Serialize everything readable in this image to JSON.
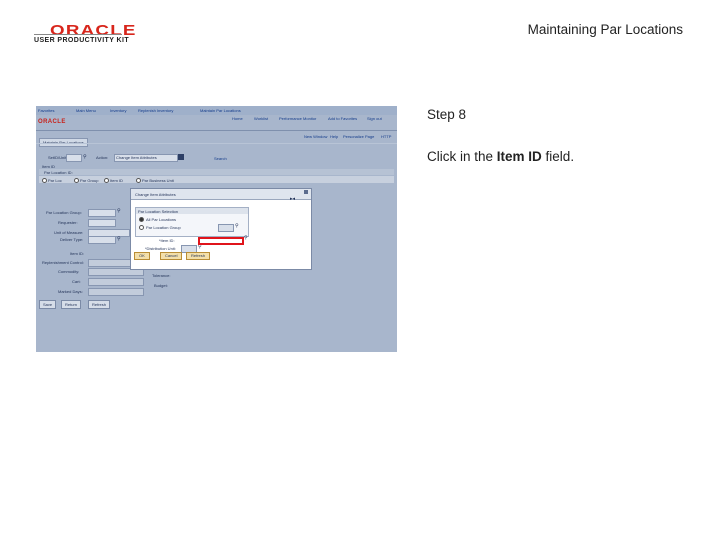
{
  "header": {
    "logo_oracle": "ORACLE",
    "logo_upk": "USER PRODUCTIVITY KIT",
    "title": "Maintaining Par Locations"
  },
  "step": {
    "title": "Step 8",
    "instruction_before": "Click in the ",
    "instruction_bold": "Item ID",
    "instruction_after": " field."
  },
  "screenshot": {
    "nav_items": [
      "Favorites",
      "Main Menu",
      "Inventory",
      "Replenish Inventory",
      "Maintain Par Locations"
    ],
    "header_links": [
      "Home",
      "Worklist",
      "Performance Monitor",
      "Add to Favorites",
      "Sign out"
    ],
    "brand": "ORACLE",
    "toolbar_links": [
      "New Window",
      "Help",
      "Personalize Page",
      "HTTP"
    ],
    "page_tab": "Maintain Par Locations",
    "labels": {
      "unit": "SetID/Unit:",
      "action": "Action:",
      "action_value": "Change Item Attributes",
      "search": "Search",
      "item_id": "Item ID",
      "par_location": "Par Location ID:",
      "par_group": "Par Location Group:",
      "requester": "Requester:",
      "unit_of_measure": "Unit of Measure:",
      "deliver_type": "Deliver Type:",
      "item_id2": "Item ID:",
      "replenish": "Replenishment Control:",
      "commodity": "Commodity:",
      "cart": "Cart:",
      "tolerance": "Tolerance:",
      "budget": "Budget:",
      "mark_days": "Marked Days:"
    },
    "radio_options": [
      "Par Loc",
      "Par Group",
      "Item ID",
      "Par Business Unit"
    ],
    "bottom_buttons": [
      "Save",
      "Return",
      "Refresh"
    ],
    "modal": {
      "title": "Change Item Attributes",
      "section_title": "Par Location Selection",
      "options": [
        "All Par Locations",
        "Par Location Group"
      ],
      "item_label": "*Item ID:",
      "distrib_label": "*Distribution Unit:",
      "buttons": [
        "OK",
        "Cancel",
        "Refresh"
      ]
    }
  }
}
